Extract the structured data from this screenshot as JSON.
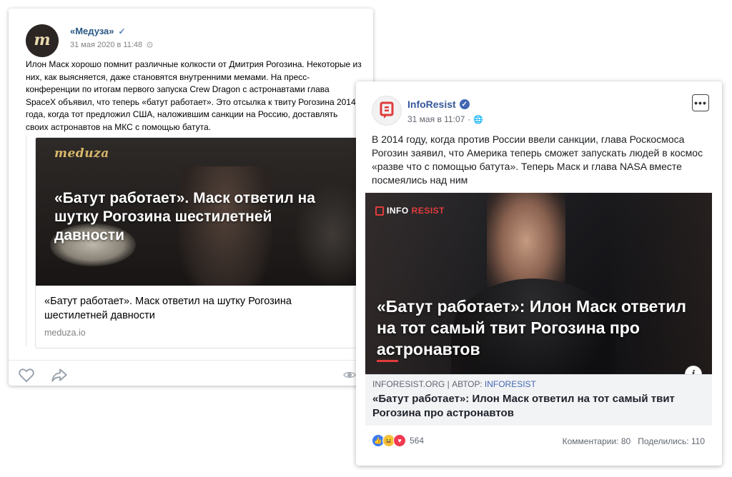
{
  "vk_post": {
    "author": "«Медуза»",
    "avatar_letter": "m",
    "date": "31 мая 2020 в 11:48",
    "text": "Илон Маск хорошо помнит различные колкости от Дмитрия Рогозина. Некоторые из них, как выясняется, даже становятся внутренними мемами. На пресс-конференции по итогам первого запуска Crew Dragon с астронавтами глава SpaceX объявил, что теперь «батут работает». Это отсылка к твиту Рогозина 2014 года, когда тот предложил США, наложившим санкции на Россию, доставлять своих астронавтов на МКС с помощью батута.",
    "image_logo": "meduza",
    "image_title": "«Батут работает». Маск ответил на шутку Рогозина шестилетней давности",
    "link_title": "«Батут работает». Маск ответил на шутку Рогозина шестилетней давности",
    "link_domain": "meduza.io"
  },
  "fb_post": {
    "author": "InfoResist",
    "date": "31 мая в 11:07",
    "text": "В 2014 году, когда против России ввели санкции, глава Роскосмоса Рогозин заявил, что Америка теперь сможет запускать людей в космос «разве что с помощью батута». Теперь Маск и глава NASA вместе посмеялись над ним",
    "image_logo_white": "INFO",
    "image_logo_red": "RESIST",
    "image_title": "«Батут работает»: Илон Маск ответил на тот самый твит Рогозина про астронавтов",
    "link_meta_site": "INFORESIST.ORG | АВТОР: ",
    "link_meta_author": "INFORESIST",
    "link_title": "«Батут работает»: Илон Маск ответил на тот самый твит Рогозина про астронавтов",
    "reactions_count": "564",
    "comments": "Комментарии: 80",
    "shares": "Поделились: 110"
  },
  "colors": {
    "vk_link": "#2a5885",
    "fb_link": "#365899",
    "fb_like": "#3c7cf0",
    "fb_love": "#f0384e",
    "fb_haha": "#f6c13d"
  }
}
